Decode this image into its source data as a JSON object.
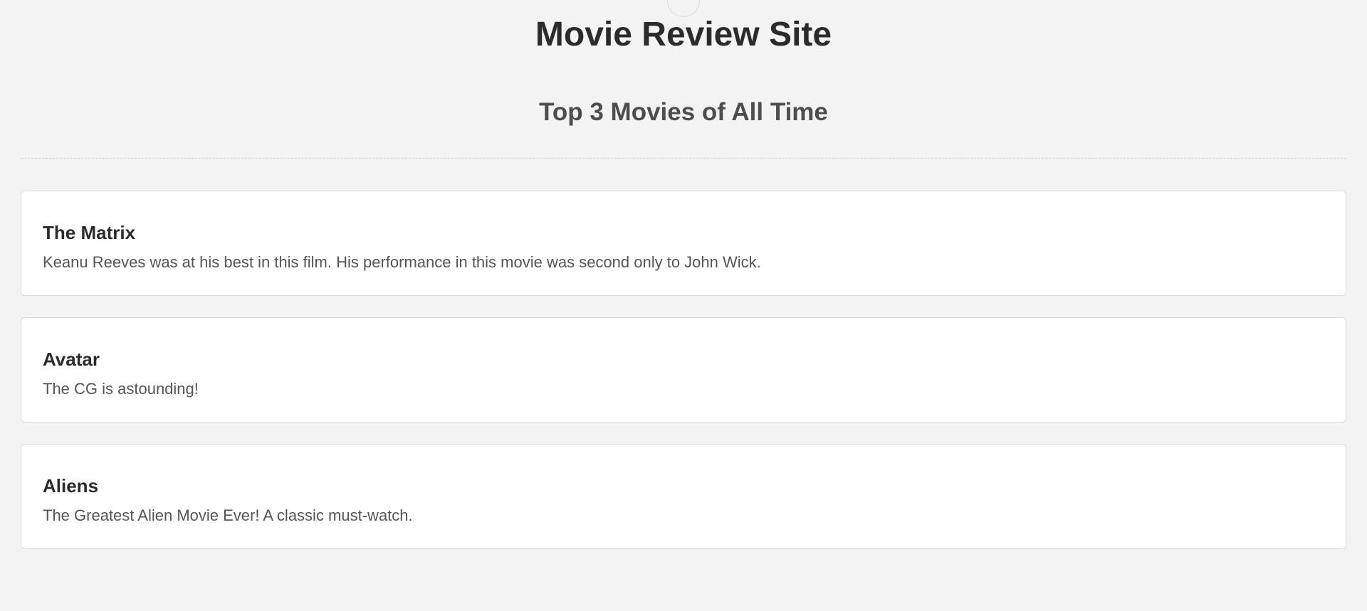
{
  "header": {
    "site_title": "Movie Review Site"
  },
  "main": {
    "section_title": "Top 3 Movies of All Time",
    "movies": [
      {
        "title": "The Matrix",
        "review": "Keanu Reeves was at his best in this film. His performance in this movie was second only to John Wick."
      },
      {
        "title": "Avatar",
        "review": "The CG is astounding!"
      },
      {
        "title": "Aliens",
        "review": "The Greatest Alien Movie Ever! A classic must-watch."
      }
    ]
  }
}
